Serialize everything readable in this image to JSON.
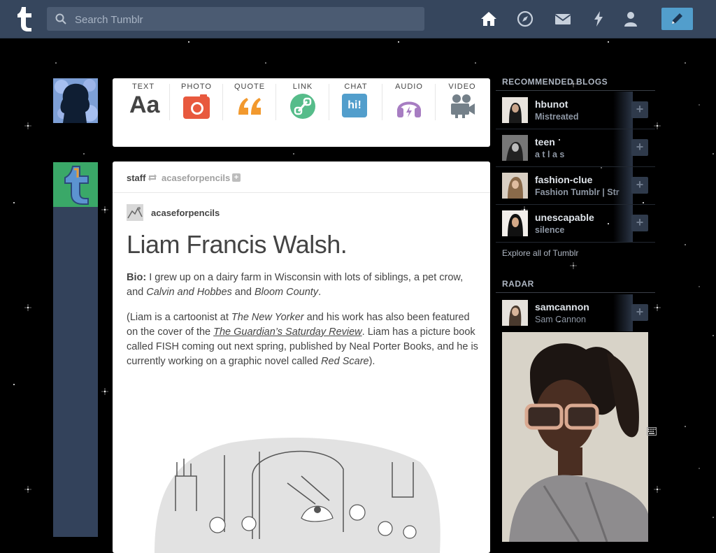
{
  "topbar": {
    "search_placeholder": "Search Tumblr",
    "icons": [
      "home-icon",
      "explore-icon",
      "mail-icon",
      "activity-icon",
      "account-icon"
    ],
    "compose_icon": "pencil-icon",
    "colors": {
      "bar": "#36465d",
      "compose": "#529ecc"
    }
  },
  "post_types": [
    {
      "label": "TEXT",
      "icon": "text-icon"
    },
    {
      "label": "PHOTO",
      "icon": "camera-icon"
    },
    {
      "label": "QUOTE",
      "icon": "quote-icon"
    },
    {
      "label": "LINK",
      "icon": "link-icon"
    },
    {
      "label": "CHAT",
      "icon": "chat-icon"
    },
    {
      "label": "AUDIO",
      "icon": "headphones-icon"
    },
    {
      "label": "VIDEO",
      "icon": "video-camera-icon"
    }
  ],
  "text_type_glyph": "Aa",
  "chat_type_glyph": "hi!",
  "post": {
    "reblogger": "staff",
    "reblogged_from": "acaseforpencils",
    "source_user": "acaseforpencils",
    "title": "Liam Francis Walsh.",
    "bio_label": "Bio:",
    "bio_text_1": " I grew up on a dairy farm in Wisconsin with lots of siblings, a pet crow, and ",
    "bio_italic_1": "Calvin and Hobbes",
    "bio_text_2": " and ",
    "bio_italic_2": "Bloom County",
    "bio_text_3": ".",
    "p2_text_1": "(Liam is a cartoonist at ",
    "p2_italic_1": "The New Yorker",
    "p2_text_2": " and his work has also been featured on the cover of the ",
    "p2_link": "The Guardian’s Saturday Review",
    "p2_text_3": ". Liam has a picture book called FISH coming out next spring, published by Neal Porter Books, and he is currently working on a graphic novel called ",
    "p2_italic_2": "Red Scare",
    "p2_text_4": ")."
  },
  "sidebar": {
    "recommended_heading": "RECOMMENDED BLOGS",
    "blogs": [
      {
        "name": "hbunot",
        "subtitle": "Mistreated"
      },
      {
        "name": "teen",
        "subtitle": "a t l a s"
      },
      {
        "name": "fashion-clue",
        "subtitle": "Fashion Tumblr | Str"
      },
      {
        "name": "unescapable",
        "subtitle": "silence"
      }
    ],
    "explore_link": "Explore all of Tumblr",
    "radar_heading": "RADAR",
    "radar": {
      "name": "samcannon",
      "subtitle": "Sam Cannon"
    },
    "follow_symbol": "+"
  },
  "reblog_follow_symbol": "+"
}
